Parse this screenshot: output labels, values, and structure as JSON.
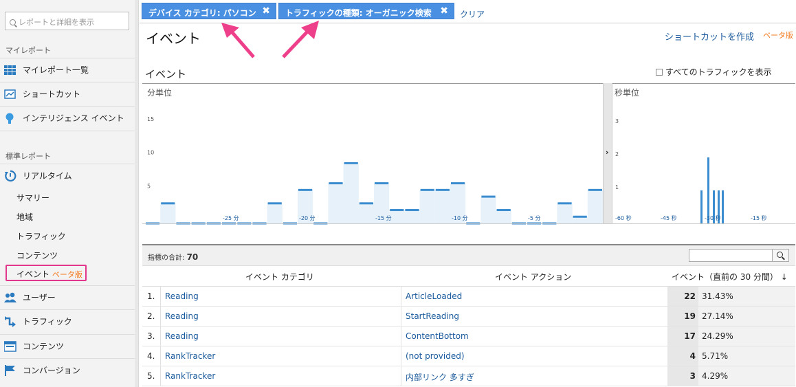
{
  "sidebar": {
    "search_placeholder": "レポートと詳細を表示",
    "my_reports_title": "マイレポート",
    "items_top": [
      {
        "label": "マイレポート一覧",
        "icon": "grid-icon"
      },
      {
        "label": "ショートカット",
        "icon": "shortcut-icon"
      },
      {
        "label": "インテリジェンス イベント",
        "icon": "lightbulb-icon"
      }
    ],
    "standard_reports_title": "標準レポート",
    "realtime": {
      "label": "リアルタイム",
      "icon": "clock-refresh-icon"
    },
    "realtime_sub": [
      "サマリー",
      "地域",
      "トラフィック",
      "コンテンツ"
    ],
    "events_label": "イベント",
    "events_beta": "ベータ版",
    "items_bottom": [
      {
        "label": "ユーザー",
        "icon": "users-icon"
      },
      {
        "label": "トラフィック",
        "icon": "traffic-arrow-icon"
      },
      {
        "label": "コンテンツ",
        "icon": "content-icon"
      },
      {
        "label": "コンバージョン",
        "icon": "flag-icon"
      }
    ]
  },
  "filters": {
    "chips": [
      {
        "label": "デバイス カテゴリ: パソコン"
      },
      {
        "label": "トラフィックの種類: オーガニック検索"
      }
    ],
    "clear": "クリア"
  },
  "header": {
    "title": "イベント",
    "shortcut": "ショートカットを作成",
    "shortcut_beta": "ベータ版"
  },
  "section": {
    "title": "イベント",
    "show_all": "すべてのトラフィックを表示"
  },
  "colors": {
    "bar": "#3b8dd0",
    "fill": "#e6f1f9",
    "annotation": "#ee3f8b",
    "chip": "#4a90e2"
  },
  "chart_data": [
    {
      "type": "bar",
      "title": "分単位",
      "ylim": [
        0,
        15
      ],
      "yticks": [
        5,
        10,
        15
      ],
      "xtick_labels": [
        "-25 分",
        "-20 分",
        "-15 分",
        "-10 分",
        "-5 分"
      ],
      "values": [
        0,
        3,
        0,
        0,
        0,
        0,
        0,
        0,
        3,
        0,
        5,
        0,
        6,
        9,
        3,
        6,
        2,
        2,
        5,
        5,
        6,
        0,
        4,
        2,
        0,
        0,
        0,
        3,
        1,
        5
      ]
    },
    {
      "type": "bar",
      "title": "秒単位",
      "ylim": [
        0,
        3
      ],
      "yticks": [
        1,
        2,
        3
      ],
      "xtick_labels": [
        "-60 秒",
        "-45 秒",
        "-30 秒",
        "-15 秒"
      ],
      "values": [
        1,
        2,
        1,
        1,
        1
      ]
    }
  ],
  "table": {
    "total_label": "指標の合計:",
    "total_value": "70",
    "col_category": "イベント カテゴリ",
    "col_action": "イベント アクション",
    "col_events": "イベント（直前の 30 分間）",
    "sort_icon": "down-arrow-icon",
    "rows": [
      {
        "n": "1.",
        "cat": "Reading",
        "act": "ArticleLoaded",
        "cnt": "22",
        "pct": "31.43%"
      },
      {
        "n": "2.",
        "cat": "Reading",
        "act": "StartReading",
        "cnt": "19",
        "pct": "27.14%"
      },
      {
        "n": "3.",
        "cat": "Reading",
        "act": "ContentBottom",
        "cnt": "17",
        "pct": "24.29%"
      },
      {
        "n": "4.",
        "cat": "RankTracker",
        "act": "(not provided)",
        "cnt": "4",
        "pct": "5.71%"
      },
      {
        "n": "5.",
        "cat": "RankTracker",
        "act": "内部リンク 多すぎ",
        "cnt": "3",
        "pct": "4.29%"
      }
    ]
  }
}
